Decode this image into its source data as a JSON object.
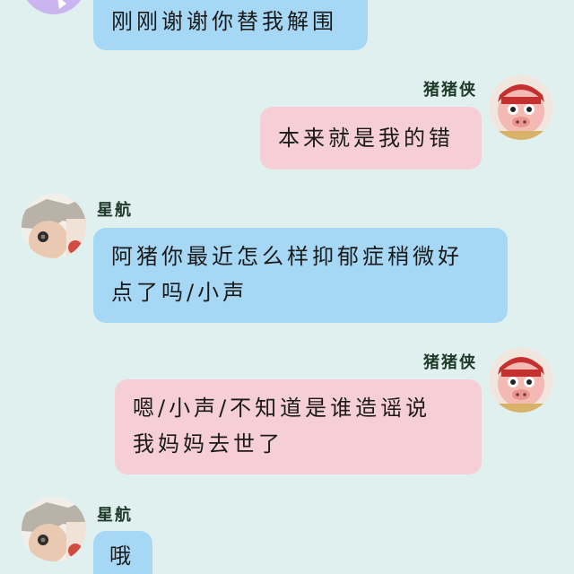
{
  "messages": [
    {
      "sender": "",
      "side": "left",
      "lines": [
        "刚刚谢谢你替我解围"
      ]
    },
    {
      "sender": "猪猪侠",
      "side": "right",
      "lines": [
        "本来就是我的错"
      ]
    },
    {
      "sender": "星航",
      "side": "left",
      "lines": [
        "阿猪你最近怎么样抑郁症稍微好",
        "点了吗/小声"
      ]
    },
    {
      "sender": "猪猪侠",
      "side": "right",
      "lines": [
        "嗯/小声/不知道是谁造谣说",
        "我妈妈去世了"
      ]
    },
    {
      "sender": "星航",
      "side": "left",
      "lines": [
        "哦"
      ]
    }
  ],
  "colors": {
    "background": "#dff0ee",
    "left_bubble": "#a6d8f5",
    "right_bubble": "#f6cfd6"
  },
  "icons": {
    "pig_avatar": "pig-hero-avatar-icon",
    "xinghang_avatar": "xinghang-avatar-icon"
  }
}
